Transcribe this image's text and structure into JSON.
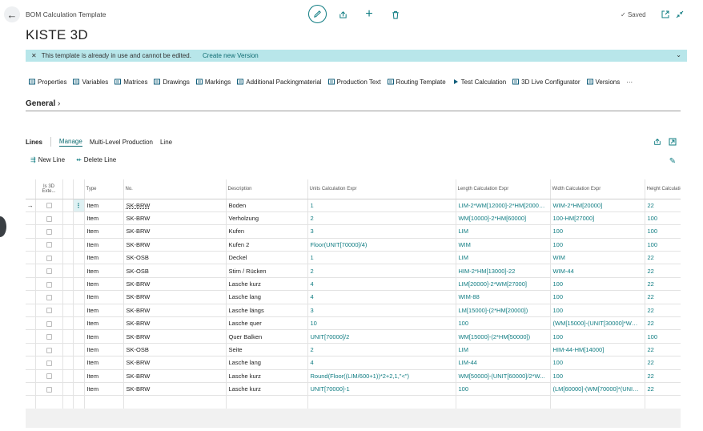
{
  "header": {
    "breadcrumb": "BOM Calculation Template",
    "title": "KISTE 3D",
    "saved_label": "Saved"
  },
  "banner": {
    "message": "This template is already in use and cannot be edited.",
    "link": "Create new Version"
  },
  "actions": [
    {
      "label": "Properties",
      "icon": "properties-icon"
    },
    {
      "label": "Variables",
      "icon": "variables-icon"
    },
    {
      "label": "Matrices",
      "icon": "matrices-icon"
    },
    {
      "label": "Drawings",
      "icon": "drawings-icon"
    },
    {
      "label": "Markings",
      "icon": "markings-icon"
    },
    {
      "label": "Additional Packingmaterial",
      "icon": "packing-icon"
    },
    {
      "label": "Production Text",
      "icon": "text-icon"
    },
    {
      "label": "Routing Template",
      "icon": "routing-icon"
    },
    {
      "label": "Test Calculation",
      "icon": "play-icon"
    },
    {
      "label": "3D Live Configurator",
      "icon": "configurator-icon"
    },
    {
      "label": "Versions",
      "icon": "versions-icon"
    },
    {
      "label": "···",
      "icon": "more-icon"
    }
  ],
  "general": {
    "label": "General"
  },
  "lines": {
    "title": "Lines",
    "tabs": [
      "Manage",
      "Multi-Level Production",
      "Line"
    ],
    "new_line": "New Line",
    "delete_line": "Delete Line"
  },
  "table": {
    "headers": [
      "Is 3D Exte...",
      "Type",
      "No.",
      "Description",
      "Units Calculation Expr",
      "Length Calculation Expr",
      "Width Calculation Expr",
      "Height Calculation Ex"
    ],
    "rows": [
      {
        "type": "Item",
        "no": "SK-BRW",
        "desc": "Boden",
        "units": "1",
        "length": "LIM-2*WM[12000]-2*HM[20000]...",
        "width": "WIM-2*HM[20000]",
        "height": "22"
      },
      {
        "type": "Item",
        "no": "SK-BRW",
        "desc": "Verholzung",
        "units": "2",
        "length": "WM[10000]-2*HM[60000]",
        "width": "100-HM[27000]",
        "height": "100"
      },
      {
        "type": "Item",
        "no": "SK-BRW",
        "desc": "Kufen",
        "units": "3",
        "length": "LIM",
        "width": "100",
        "height": "100"
      },
      {
        "type": "Item",
        "no": "SK-BRW",
        "desc": "Kufen 2",
        "units": "Floor(UNIT[70000]/4)",
        "length": "WIM",
        "width": "100",
        "height": "100"
      },
      {
        "type": "Item",
        "no": "SK-OSB",
        "desc": "Deckel",
        "units": "1",
        "length": "LIM",
        "width": "WIM",
        "height": "22"
      },
      {
        "type": "Item",
        "no": "SK-OSB",
        "desc": "Stirn / Rücken",
        "units": "2",
        "length": "HIM-2*HM[13000]-22",
        "width": "WIM-44",
        "height": "22"
      },
      {
        "type": "Item",
        "no": "SK-BRW",
        "desc": "Lasche kurz",
        "units": "4",
        "length": "LIM[20000]-2*WM[27000]",
        "width": "100",
        "height": "22"
      },
      {
        "type": "Item",
        "no": "SK-BRW",
        "desc": "Lasche lang",
        "units": "4",
        "length": "WIM-88",
        "width": "100",
        "height": "22"
      },
      {
        "type": "Item",
        "no": "SK-BRW",
        "desc": "Lasche längs",
        "units": "3",
        "length": "LM[15000]-(2*HM[20000])",
        "width": "100",
        "height": "22"
      },
      {
        "type": "Item",
        "no": "SK-BRW",
        "desc": "Lasche quer",
        "units": "10",
        "length": "100",
        "width": "(WM[15000]-(UNIT[30000]*WM[...",
        "height": "22"
      },
      {
        "type": "Item",
        "no": "SK-BRW",
        "desc": "Quer Balken",
        "units": "UNIT[70000]/2",
        "length": "WM[15000]-(2*HM[50000])",
        "width": "100",
        "height": "100"
      },
      {
        "type": "Item",
        "no": "SK-OSB",
        "desc": "Seite",
        "units": "2",
        "length": "LIM",
        "width": "HIM-44-HM[14000]",
        "height": "22"
      },
      {
        "type": "Item",
        "no": "SK-BRW",
        "desc": "Lasche lang",
        "units": "4",
        "length": "LIM-44",
        "width": "100",
        "height": "22"
      },
      {
        "type": "Item",
        "no": "SK-BRW",
        "desc": "Lasche kurz",
        "units": "Round(Floor((LIM/600+1))*2+2,1,\"<\")",
        "length": "WM[50000]-(UNIT[60000]/2*W...",
        "width": "100",
        "height": "22"
      },
      {
        "type": "Item",
        "no": "SK-BRW",
        "desc": "Lasche kurz",
        "units": "UNIT[70000]-1",
        "length": "100",
        "width": "(LM[60000]-(WM[70000]*(UNIT[...",
        "height": "22"
      }
    ]
  },
  "colors": {
    "accent": "#0f7c82",
    "banner": "#b8e6ea"
  }
}
